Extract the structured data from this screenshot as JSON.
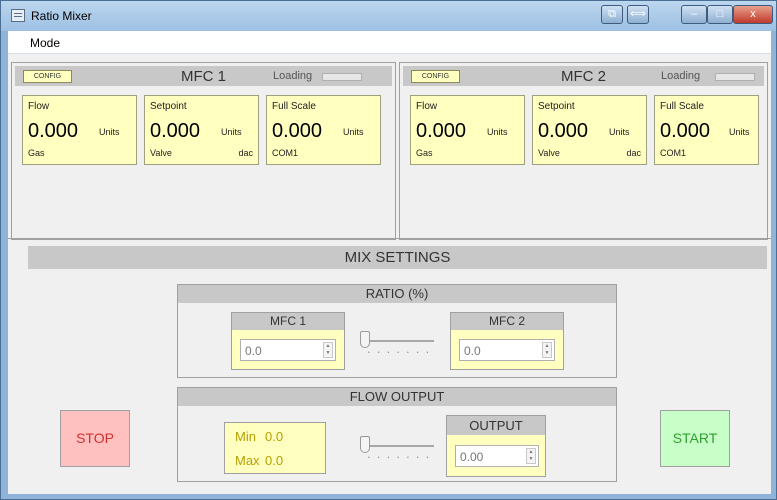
{
  "window": {
    "title": "Ratio Mixer",
    "buttons": [
      "⧉",
      "⟺",
      "–",
      "□",
      "x"
    ]
  },
  "menu": {
    "mode": "Mode"
  },
  "mfc1": {
    "config": "CONFIG",
    "title": "MFC 1",
    "loading": "Loading",
    "flow": {
      "title": "Flow",
      "value": "0.000",
      "units": "Units",
      "sub": "Gas"
    },
    "setpoint": {
      "title": "Setpoint",
      "value": "0.000",
      "units": "Units",
      "sub": "Valve",
      "sub2": "dac"
    },
    "fullscale": {
      "title": "Full Scale",
      "value": "0.000",
      "units": "Units",
      "sub": "COM1"
    }
  },
  "mfc2": {
    "config": "CONFIG",
    "title": "MFC 2",
    "loading": "Loading",
    "flow": {
      "title": "Flow",
      "value": "0.000",
      "units": "Units",
      "sub": "Gas"
    },
    "setpoint": {
      "title": "Setpoint",
      "value": "0.000",
      "units": "Units",
      "sub": "Valve",
      "sub2": "dac"
    },
    "fullscale": {
      "title": "Full Scale",
      "value": "0.000",
      "units": "Units",
      "sub": "COM1"
    }
  },
  "mix": {
    "title": "MIX SETTINGS",
    "ratio": {
      "title": "RATIO (%)",
      "mfc1_label": "MFC 1",
      "mfc1_value": "0.0",
      "mfc2_label": "MFC 2",
      "mfc2_value": "0.0"
    },
    "flow_output": {
      "title": "FLOW OUTPUT",
      "min_label": "Min",
      "min_value": "0.0",
      "max_label": "Max",
      "max_value": "0.0",
      "output_label": "OUTPUT",
      "output_value": "0.00"
    },
    "stop": "STOP",
    "start": "START"
  },
  "colors": {
    "stop": "#ffc0c0",
    "start": "#c8ffc8",
    "card": "#ffffc0",
    "header": "#c8c8c8"
  }
}
